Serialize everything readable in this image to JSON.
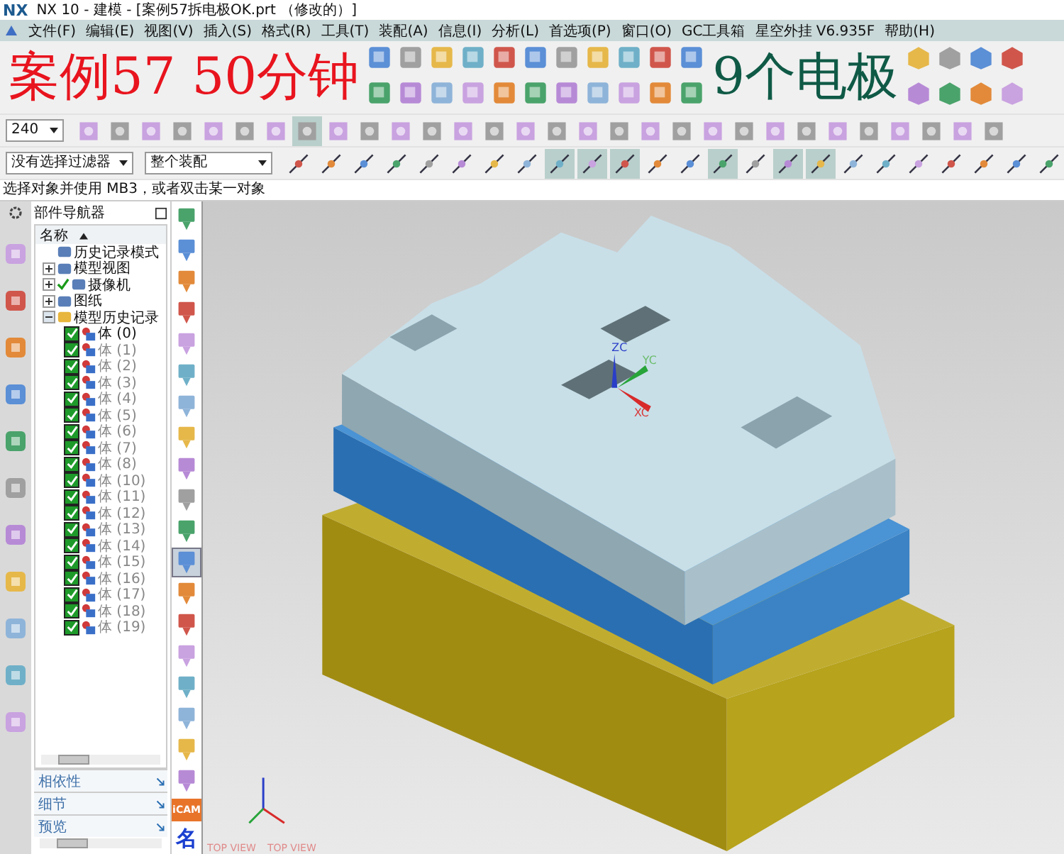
{
  "window": {
    "logo": "NX",
    "title": "NX 10 - 建模 - [案例57拆电极OK.prt （修改的）]"
  },
  "menu": [
    "文件(F)",
    "编辑(E)",
    "视图(V)",
    "插入(S)",
    "格式(R)",
    "工具(T)",
    "装配(A)",
    "信息(I)",
    "分析(L)",
    "首选项(P)",
    "窗口(O)",
    "GC工具箱",
    "星空外挂 V6.935F",
    "帮助(H)"
  ],
  "overlay_captions": [
    {
      "text": "案例57  50分钟",
      "color": "#e8141e"
    },
    {
      "text": "9个电极",
      "color": "#0f5a46"
    }
  ],
  "toolbar": {
    "scale_dropdown": "240",
    "selection_filter": "没有选择过滤器",
    "assembly_scope": "整个装配"
  },
  "status_bar": "选择对象并使用 MB3，或者双击某一对象",
  "navigator": {
    "title": "部件导航器",
    "column": "名称",
    "items": [
      {
        "label": "历史记录模式",
        "kind": "mode",
        "expanded": false,
        "checked": false
      },
      {
        "label": "模型视图",
        "kind": "group",
        "expanded": false,
        "checked": false
      },
      {
        "label": "摄像机",
        "kind": "group",
        "expanded": false,
        "checked": true
      },
      {
        "label": "图纸",
        "kind": "group",
        "expanded": false,
        "checked": false
      },
      {
        "label": "模型历史记录",
        "kind": "group",
        "expanded": true,
        "checked": false,
        "children": [
          {
            "label": "体 (0)",
            "checked": true,
            "active": true
          },
          {
            "label": "体 (1)",
            "checked": true,
            "active": false
          },
          {
            "label": "体 (2)",
            "checked": true,
            "active": false
          },
          {
            "label": "体 (3)",
            "checked": true,
            "active": false
          },
          {
            "label": "体 (4)",
            "checked": true,
            "active": false
          },
          {
            "label": "体 (5)",
            "checked": true,
            "active": false
          },
          {
            "label": "体 (6)",
            "checked": true,
            "active": false
          },
          {
            "label": "体 (7)",
            "checked": true,
            "active": false
          },
          {
            "label": "体 (8)",
            "checked": true,
            "active": false
          },
          {
            "label": "体 (10)",
            "checked": true,
            "active": false
          },
          {
            "label": "体 (11)",
            "checked": true,
            "active": false
          },
          {
            "label": "体 (12)",
            "checked": true,
            "active": false
          },
          {
            "label": "体 (13)",
            "checked": true,
            "active": false
          },
          {
            "label": "体 (14)",
            "checked": true,
            "active": false
          },
          {
            "label": "体 (15)",
            "checked": true,
            "active": false
          },
          {
            "label": "体 (16)",
            "checked": true,
            "active": false
          },
          {
            "label": "体 (17)",
            "checked": true,
            "active": false
          },
          {
            "label": "体 (18)",
            "checked": true,
            "active": false
          },
          {
            "label": "体 (19)",
            "checked": true,
            "active": false
          }
        ]
      }
    ],
    "panels": [
      "相依性",
      "细节",
      "预览"
    ]
  },
  "resource_bar": {
    "icam_label": "iCAM",
    "name_glyph": "名"
  },
  "viewport": {
    "axis_labels": [
      "ZC",
      "YC",
      "XC"
    ],
    "view_labels": [
      "TOP VIEW",
      "TOP VIEW"
    ]
  }
}
